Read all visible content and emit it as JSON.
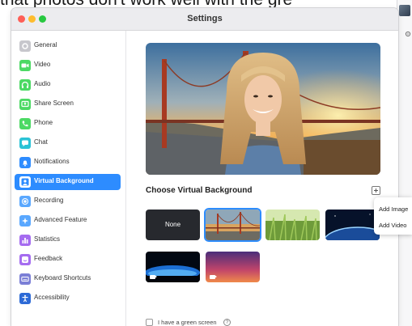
{
  "caption": "that photos don't work well with the gre",
  "window": {
    "title": "Settings"
  },
  "sidebar": {
    "items": [
      {
        "label": "General",
        "icon": "gear-icon",
        "color": "#c7c7cc"
      },
      {
        "label": "Video",
        "icon": "video-camera-icon",
        "color": "#4cd964"
      },
      {
        "label": "Audio",
        "icon": "headphones-icon",
        "color": "#4cd964"
      },
      {
        "label": "Share Screen",
        "icon": "share-screen-icon",
        "color": "#4cd964"
      },
      {
        "label": "Phone",
        "icon": "phone-icon",
        "color": "#4cd964"
      },
      {
        "label": "Chat",
        "icon": "chat-bubble-icon",
        "color": "#2bc3d6"
      },
      {
        "label": "Notifications",
        "icon": "bell-icon",
        "color": "#2d8cff"
      },
      {
        "label": "Virtual Background",
        "icon": "person-background-icon",
        "color": "#2d8cff",
        "active": true
      },
      {
        "label": "Recording",
        "icon": "record-icon",
        "color": "#5aa8ff"
      },
      {
        "label": "Advanced Feature",
        "icon": "sparkle-icon",
        "color": "#5aa8ff"
      },
      {
        "label": "Statistics",
        "icon": "bar-chart-icon",
        "color": "#a56cf0"
      },
      {
        "label": "Feedback",
        "icon": "smiley-icon",
        "color": "#a56cf0"
      },
      {
        "label": "Keyboard Shortcuts",
        "icon": "keyboard-icon",
        "color": "#7b7fd6"
      },
      {
        "label": "Accessibility",
        "icon": "accessibility-icon",
        "color": "#2d6ad6"
      }
    ]
  },
  "main": {
    "section_title": "Choose Virtual Background",
    "none_label": "None",
    "green_screen_label": "I have a green screen",
    "help_glyph": "?"
  },
  "popup": {
    "add_image": "Add Image",
    "add_video": "Add Video"
  },
  "colors": {
    "accent": "#2d8cff"
  }
}
